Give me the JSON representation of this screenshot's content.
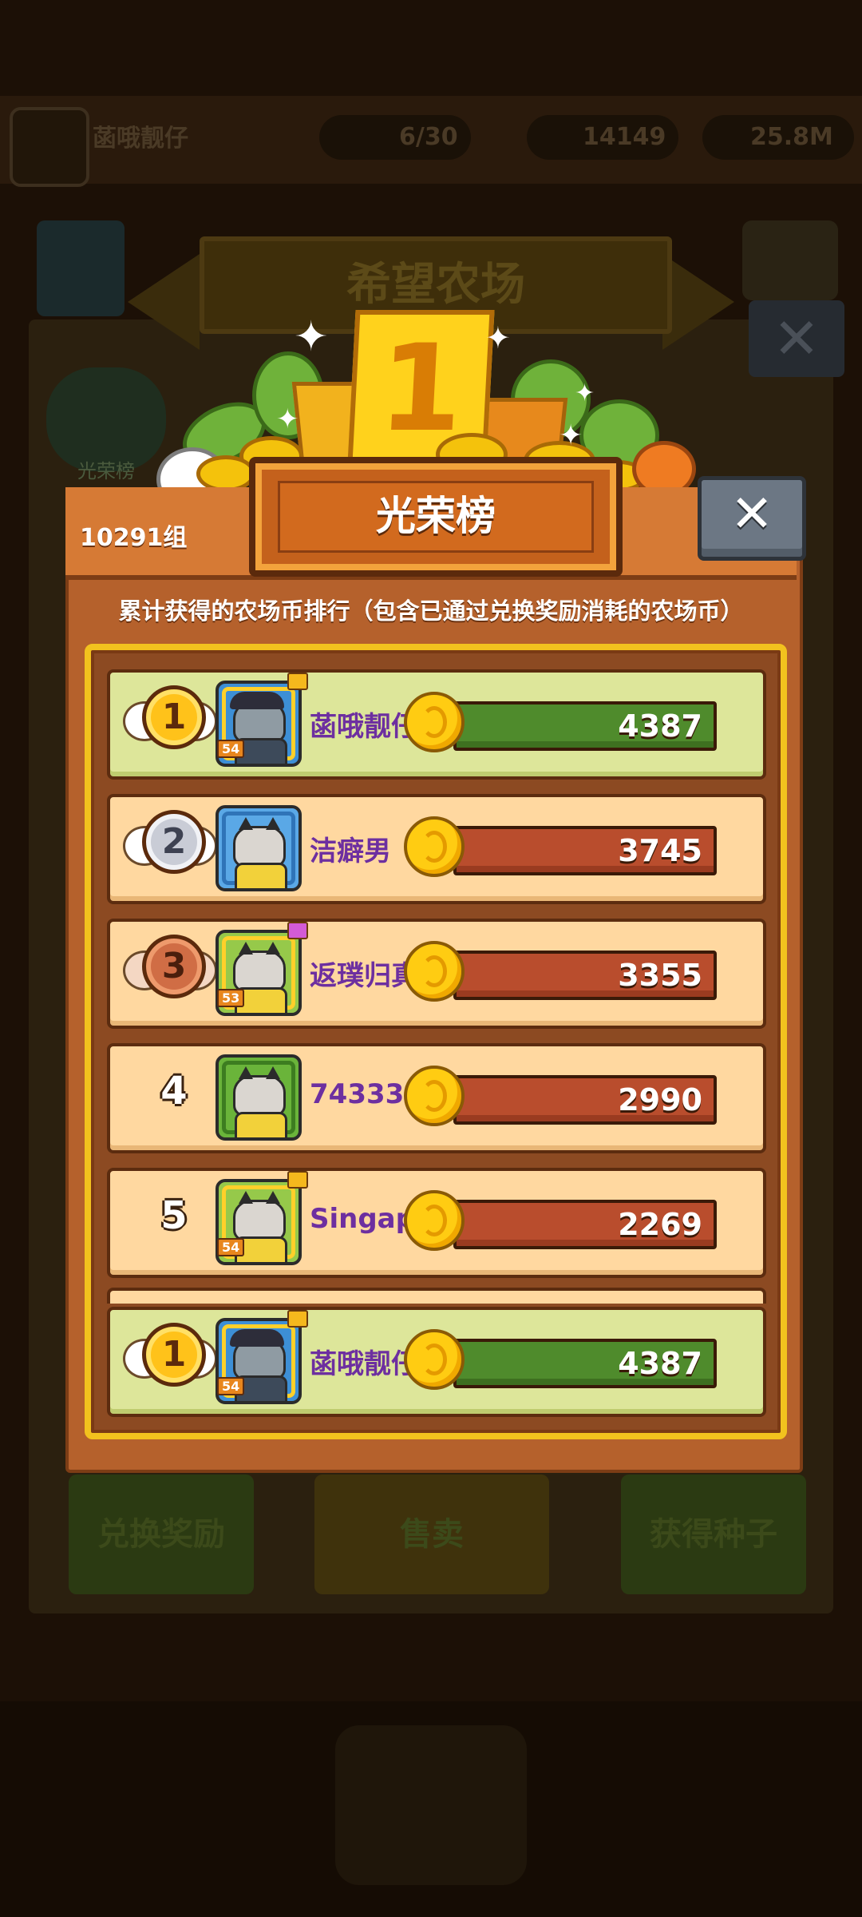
{
  "background": {
    "player_name": "菡哦靓仔",
    "plots": "6/30",
    "coins": "14149",
    "seeds": "25.8M",
    "farm_title": "希望农场",
    "glory_shortcut": "光荣榜",
    "exchange_button": "兑换奖励",
    "sell_button": "售卖",
    "get_seeds_button": "获得种子"
  },
  "modal": {
    "trophy_rank": "1",
    "title": "光荣榜",
    "group": "10291组",
    "close_label": "✕",
    "subtitle": "累计获得的农场币排行（包含已通过兑换奖励消耗的农场币）",
    "accent_colors": {
      "gold": "#f2c21e",
      "self_row": "#dde69a",
      "row": "#ffd8a0",
      "name": "#6d2fa0"
    },
    "rows": [
      {
        "rank": "1",
        "medal": "gold",
        "level": "54",
        "name": "菡哦靓仔",
        "score": "4387",
        "self": true
      },
      {
        "rank": "2",
        "medal": "silver",
        "level": "",
        "name": "洁癖男",
        "score": "3745",
        "self": false
      },
      {
        "rank": "3",
        "medal": "bronze",
        "level": "53",
        "name": "返璞归真",
        "score": "3355",
        "self": false
      },
      {
        "rank": "4",
        "medal": "none",
        "level": "",
        "name": "743336235",
        "score": "2990",
        "self": false
      },
      {
        "rank": "5",
        "medal": "none",
        "level": "54",
        "name": "Singapore",
        "score": "2269",
        "self": false
      }
    ],
    "my_row": {
      "rank": "1",
      "medal": "gold",
      "level": "54",
      "name": "菡哦靓仔",
      "score": "4387"
    }
  }
}
